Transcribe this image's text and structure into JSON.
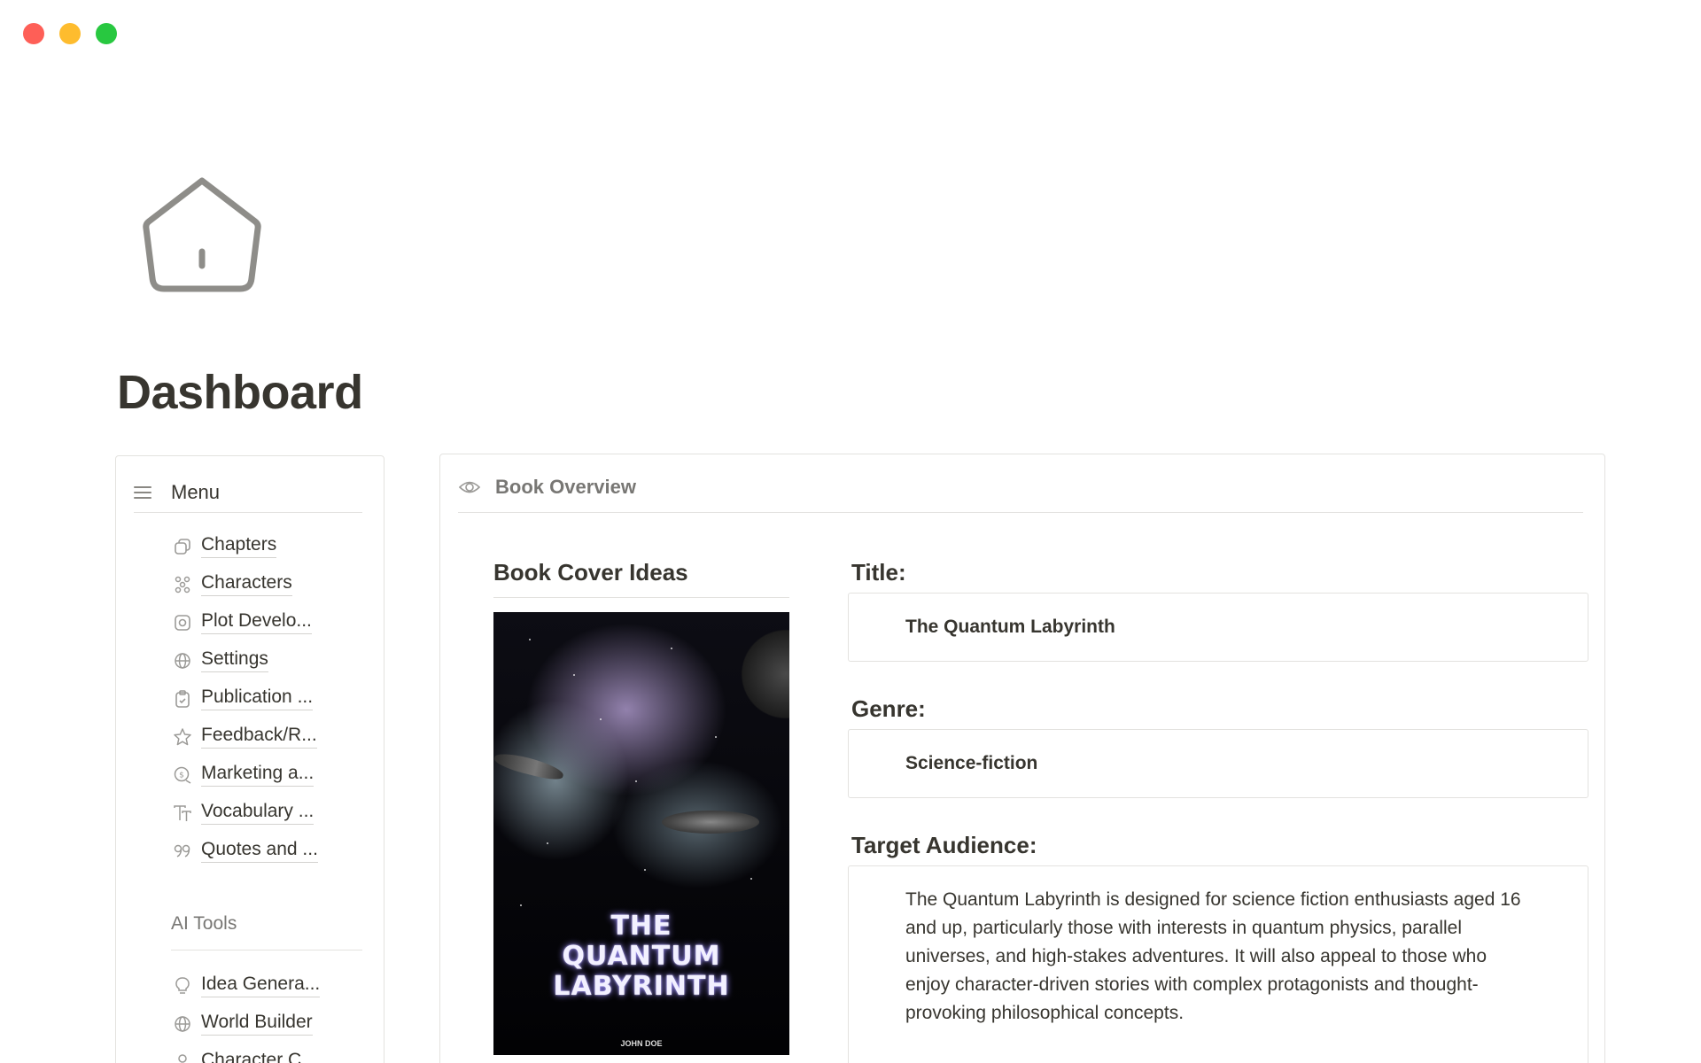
{
  "window": {
    "controls": [
      "close",
      "minimize",
      "maximize"
    ]
  },
  "page": {
    "icon": "home-icon",
    "title": "Dashboard"
  },
  "menu": {
    "heading": "Menu",
    "items": [
      {
        "label": "Chapters",
        "icon": "chapters-icon"
      },
      {
        "label": "Characters",
        "icon": "characters-icon"
      },
      {
        "label": "Plot Develo...",
        "icon": "plot-icon"
      },
      {
        "label": "Settings",
        "icon": "globe-icon"
      },
      {
        "label": "Publication ...",
        "icon": "clipboard-icon"
      },
      {
        "label": "Feedback/R...",
        "icon": "star-icon"
      },
      {
        "label": "Marketing a...",
        "icon": "marketing-icon"
      },
      {
        "label": "Vocabulary ...",
        "icon": "text-icon"
      },
      {
        "label": "Quotes and ...",
        "icon": "quote-icon"
      }
    ],
    "ai_heading": "AI Tools",
    "ai_items": [
      {
        "label": "Idea Genera...",
        "icon": "lightbulb-icon"
      },
      {
        "label": "World Builder",
        "icon": "globe-icon"
      },
      {
        "label": "Character C...",
        "icon": "person-icon"
      }
    ]
  },
  "overview": {
    "heading": "Book Overview",
    "cover_heading": "Book Cover Ideas",
    "cover": {
      "title_line1": "THE",
      "title_line2": "QUANTUM",
      "title_line3": "LABYRINTH",
      "author": "JOHN DOE"
    },
    "title_label": "Title:",
    "title_value": "The Quantum Labyrinth",
    "genre_label": "Genre:",
    "genre_value": "Science-fiction",
    "audience_label": "Target Audience:",
    "audience_value": "The Quantum Labyrinth is designed for science fiction enthusiasts aged 16 and up, particularly those with interests in quantum physics, parallel universes, and high-stakes adventures. It will also appeal to those who enjoy character-driven stories with complex protagonists and thought-provoking philosophical concepts."
  },
  "colors": {
    "close": "#fe5f57",
    "minimize": "#febc2e",
    "maximize": "#28c840",
    "text": "#37352f",
    "muted": "#787774",
    "border": "#e3e2df"
  }
}
